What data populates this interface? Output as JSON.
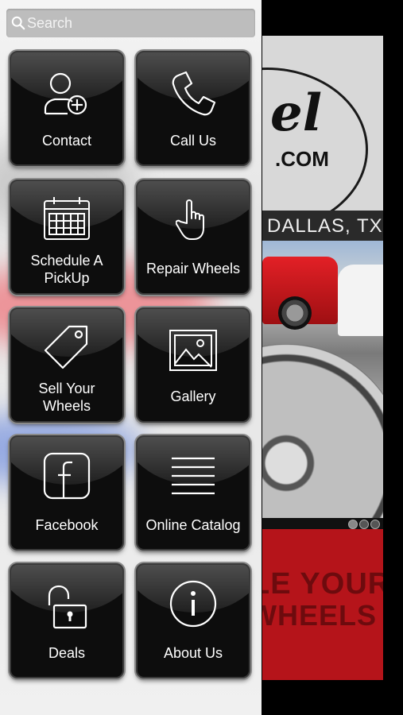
{
  "search": {
    "placeholder": "Search"
  },
  "menu": [
    {
      "label": "Contact",
      "icon": "add-user-icon"
    },
    {
      "label": "Call Us",
      "icon": "phone-icon"
    },
    {
      "label": "Schedule A\nPickUp",
      "icon": "calendar-icon"
    },
    {
      "label": "Repair Wheels",
      "icon": "pointing-hand-icon"
    },
    {
      "label": "Sell Your\nWheels",
      "icon": "price-tag-icon"
    },
    {
      "label": "Gallery",
      "icon": "image-icon"
    },
    {
      "label": "Facebook",
      "icon": "facebook-icon"
    },
    {
      "label": "Online Catalog",
      "icon": "list-icon"
    },
    {
      "label": "Deals",
      "icon": "unlocked-padlock-icon"
    },
    {
      "label": "About Us",
      "icon": "info-icon"
    }
  ],
  "background": {
    "logo_script": "el",
    "logo_domain": ".COM",
    "city": "DALLAS, TX",
    "promo_line1": "LE YOUR",
    "promo_line2": "WHEELS"
  },
  "colors": {
    "tile": "#0d0d0d",
    "promo": "#b5141a",
    "drawer": "#e8e8e8"
  }
}
